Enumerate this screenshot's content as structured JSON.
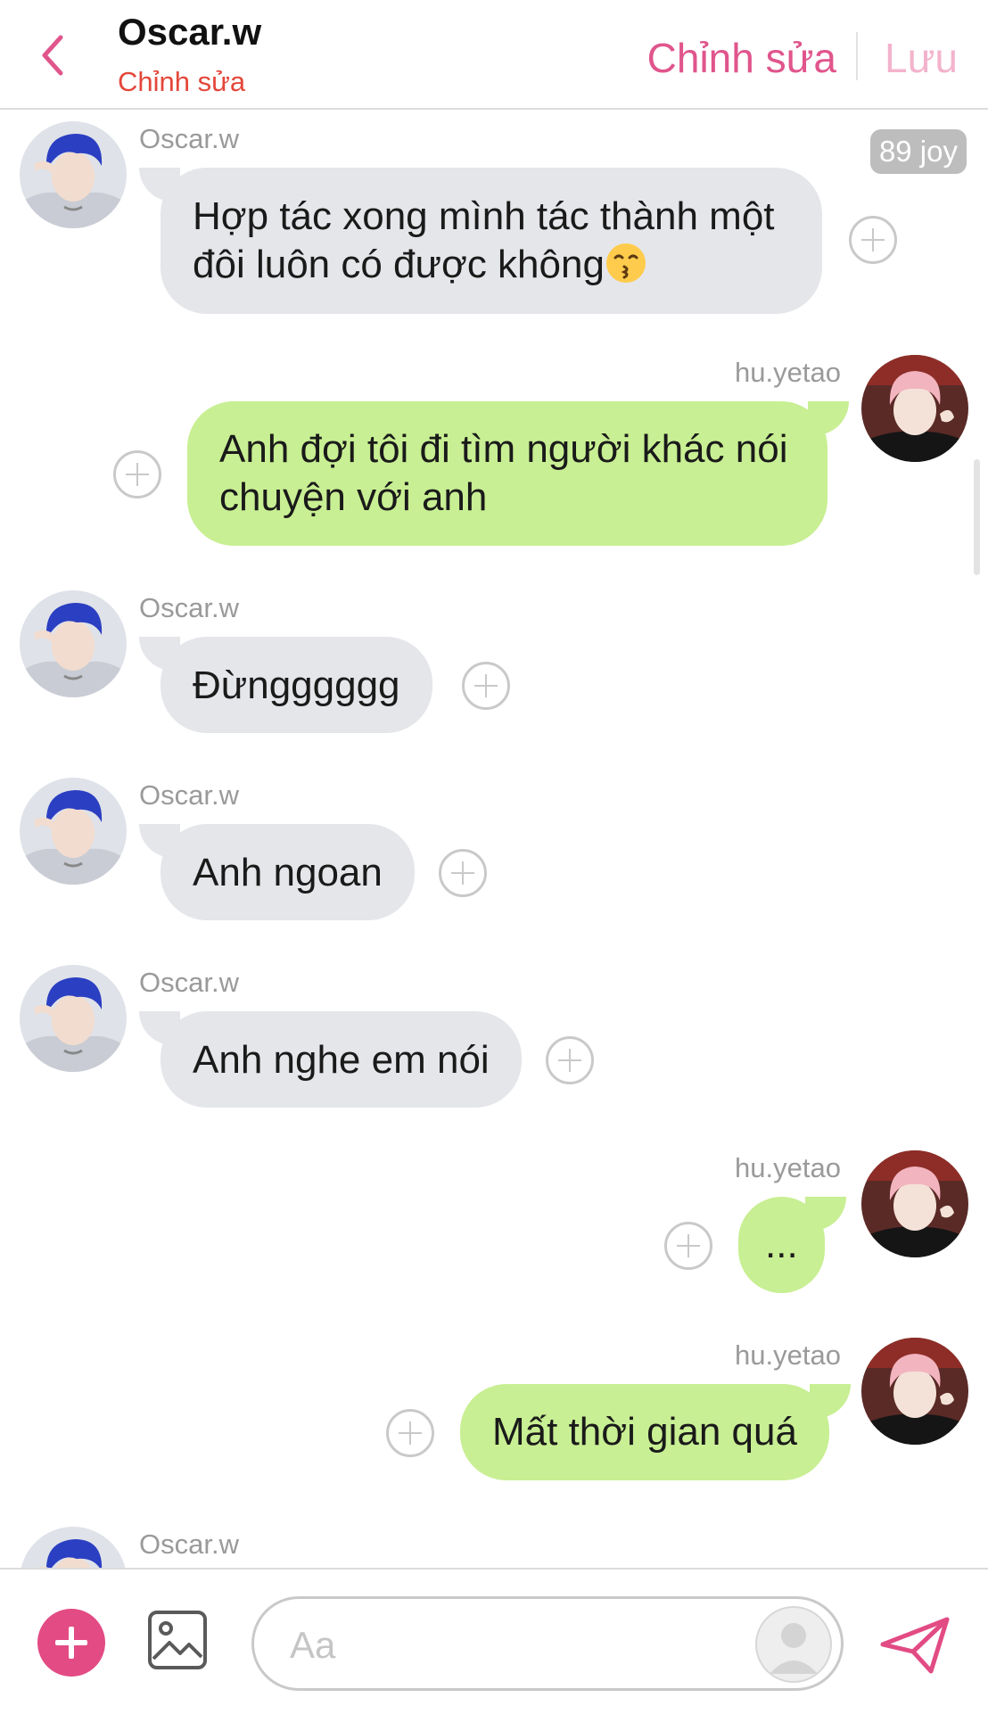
{
  "header": {
    "contact_name": "Oscar.w",
    "subtitle": "Chỉnh sửa",
    "edit_label": "Chỉnh sửa",
    "save_label": "Lưu"
  },
  "badge": {
    "joy": "89 joy"
  },
  "messages": [
    {
      "sender": "Oscar.w",
      "direction": "incoming",
      "text": "Hợp tác xong mình tác thành một đôi luôn có được không"
    },
    {
      "sender": "hu.yetao",
      "direction": "outgoing",
      "text": "Anh đợi tôi đi tìm người khác nói chuyện với anh"
    },
    {
      "sender": "Oscar.w",
      "direction": "incoming",
      "text": "Đừngggggg"
    },
    {
      "sender": "Oscar.w",
      "direction": "incoming",
      "text": "Anh ngoan"
    },
    {
      "sender": "Oscar.w",
      "direction": "incoming",
      "text": "Anh nghe em nói"
    },
    {
      "sender": "hu.yetao",
      "direction": "outgoing",
      "text": "..."
    },
    {
      "sender": "hu.yetao",
      "direction": "outgoing",
      "text": "Mất thời gian quá"
    },
    {
      "sender": "Oscar.w",
      "direction": "incoming",
      "text": ""
    }
  ],
  "composer": {
    "placeholder": "Aa"
  },
  "icons": {
    "back": "chevron-left-icon",
    "add": "plus-icon",
    "react": "plus-circle-icon",
    "gallery": "image-icon",
    "send": "send-icon",
    "emoji": "kissing-face-icon"
  },
  "colors": {
    "accent": "#e0558c",
    "subtitle": "#e4473a",
    "save_disabled": "#f3b3cc",
    "incoming_bubble": "#e5e6ea",
    "outgoing_bubble": "#c8ef93",
    "oscar_hair": "#2b3fc2",
    "huyetao_hair": "#f2b4bf"
  }
}
